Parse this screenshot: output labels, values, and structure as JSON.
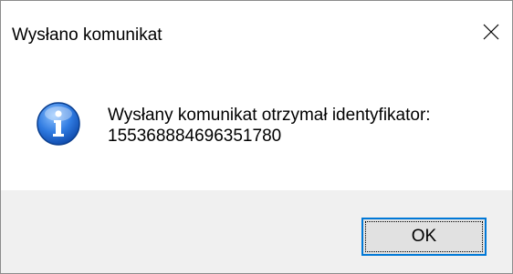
{
  "window": {
    "title": "Wysłano komunikat"
  },
  "message": {
    "line1": "Wysłany komunikat otrzymał identyfikator:",
    "line2": "155368884696351780"
  },
  "buttons": {
    "ok_label": "OK"
  },
  "icons": {
    "close": "close-icon",
    "info": "info-icon"
  },
  "colors": {
    "accent": "#0078d7",
    "footer_bg": "#f0f0f0",
    "button_bg": "#e1e1e1",
    "info_blue": "#2a6fd1"
  }
}
